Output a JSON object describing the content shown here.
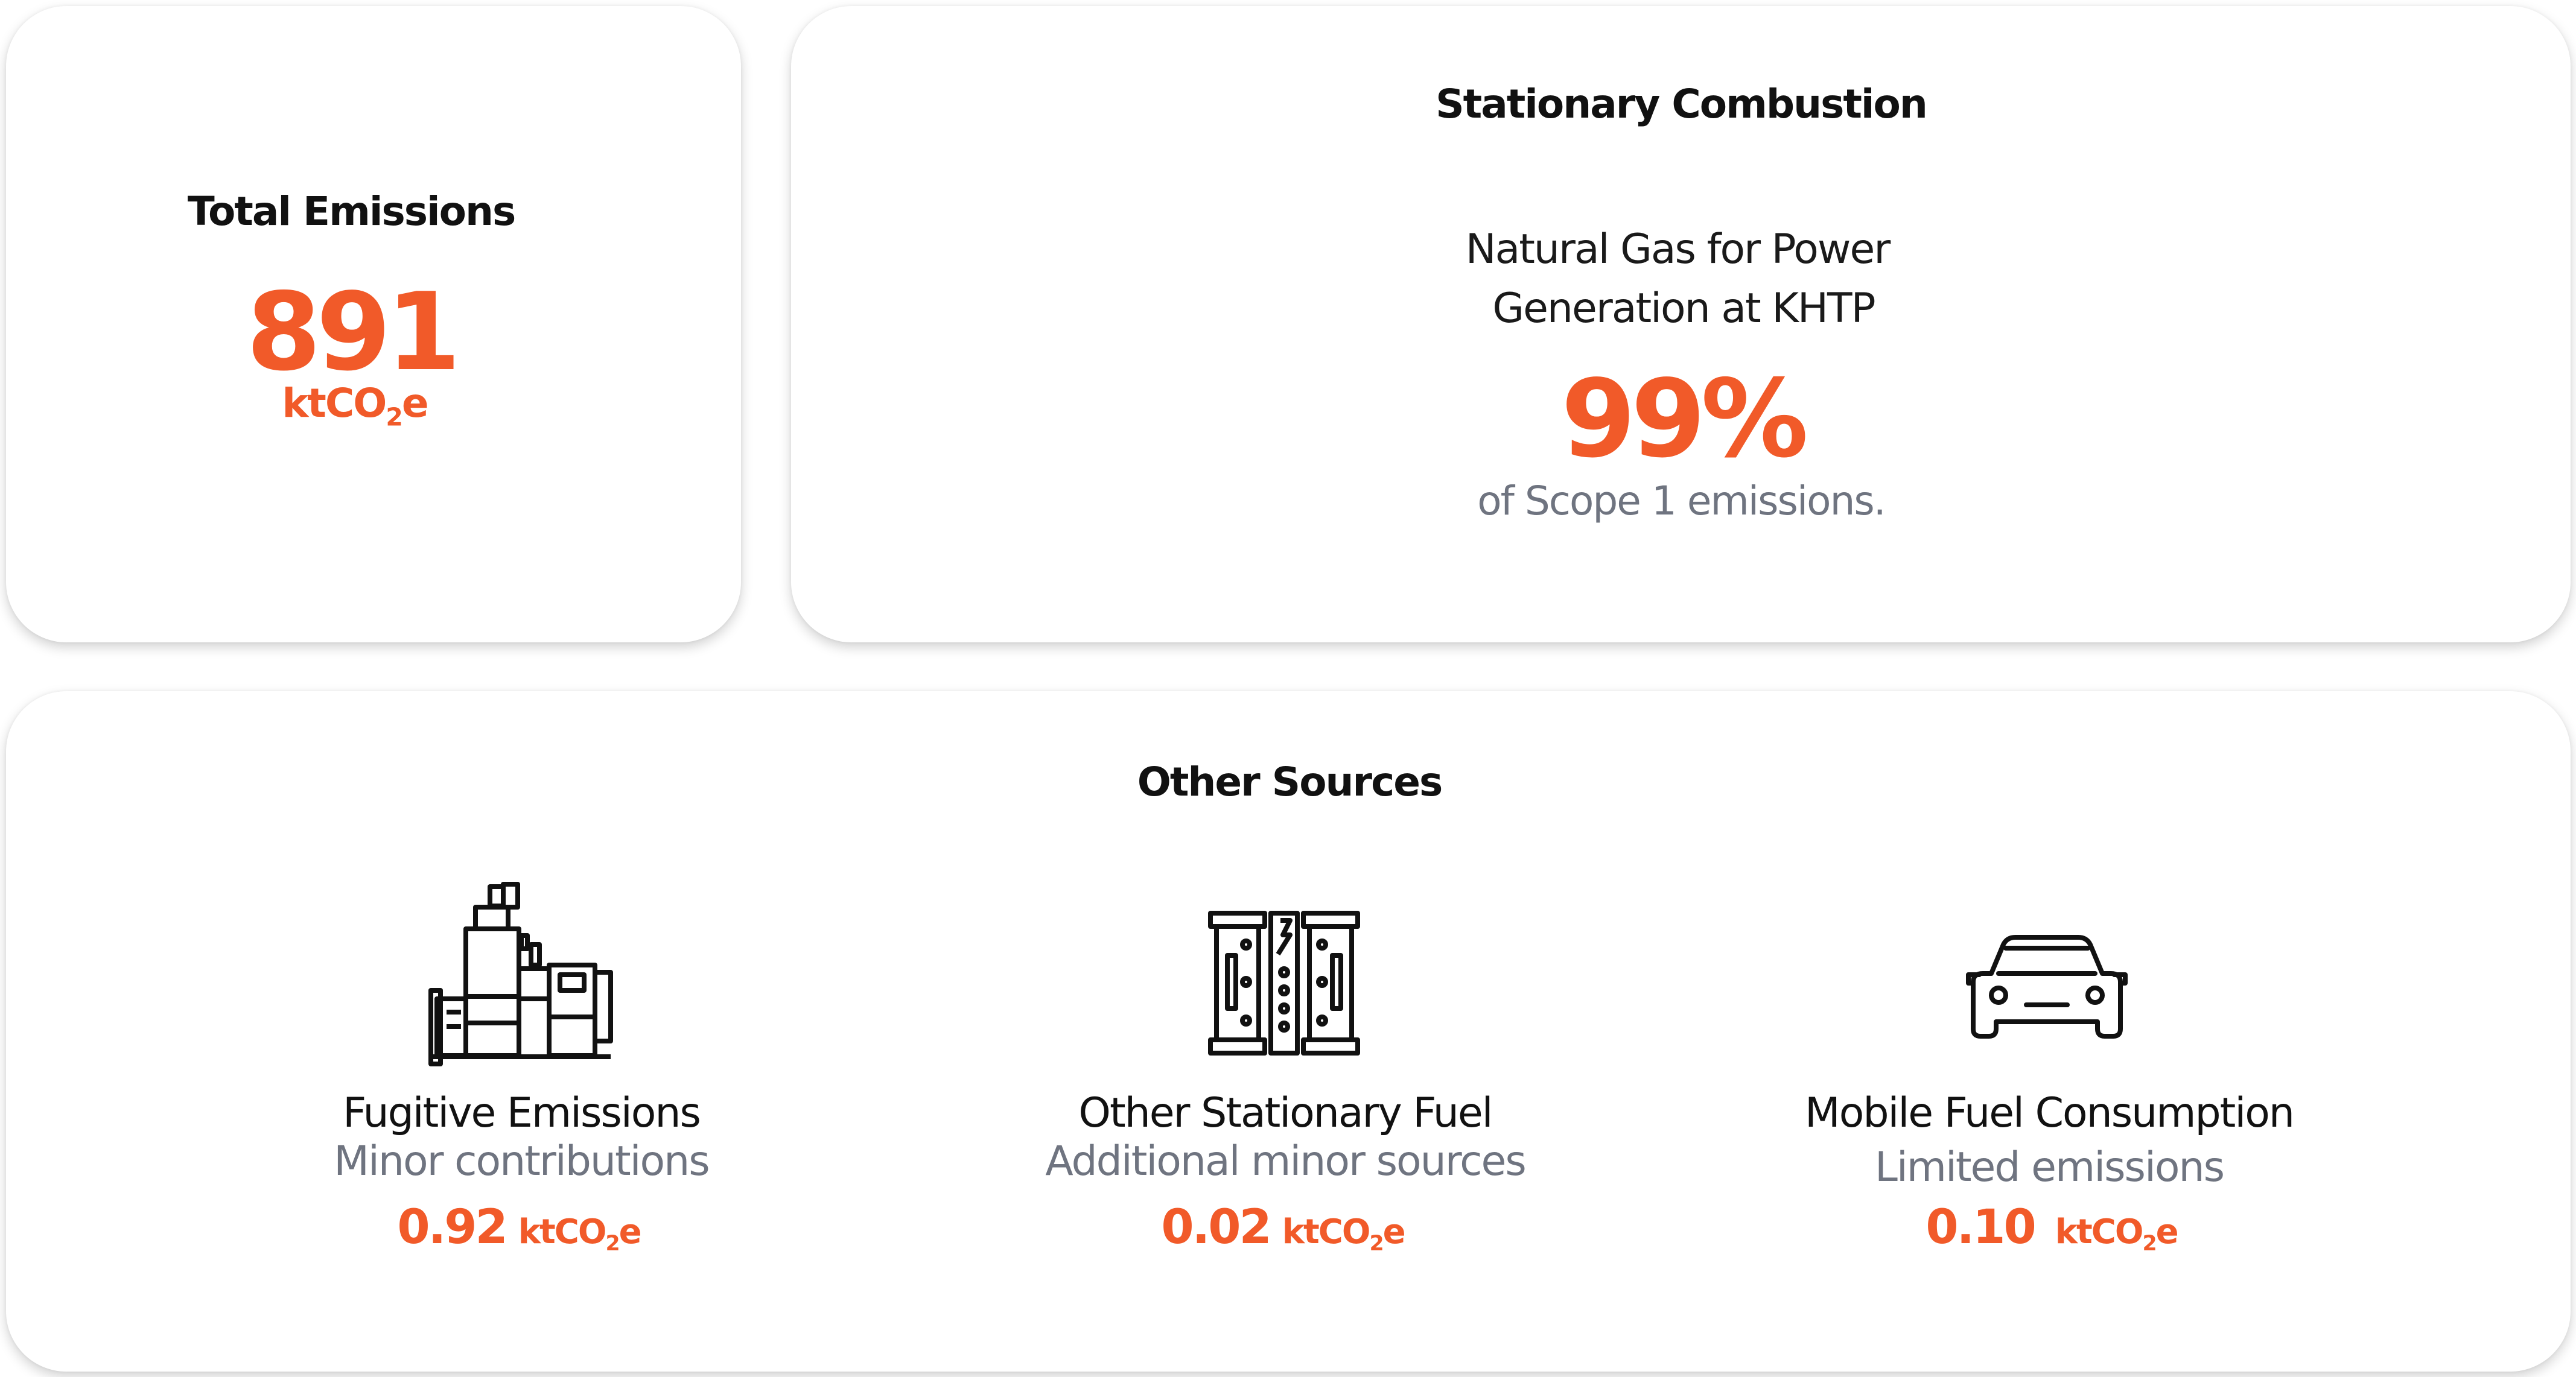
{
  "total": {
    "heading": "Total Emissions",
    "value": "891",
    "unit_prefix": "ktCO",
    "unit_sub": "2",
    "unit_suffix": "e"
  },
  "stationary": {
    "heading": "Stationary Combustion",
    "desc_line1": "Natural Gas for Power",
    "desc_line2": "Generation at KHTP",
    "percent": "99%",
    "note": "of Scope 1 emissions."
  },
  "other": {
    "heading": "Other Sources",
    "items": [
      {
        "icon": "generator-icon",
        "title": "Fugitive Emissions",
        "subtitle": "Minor contributions",
        "value": "0.92",
        "unit_prefix": "ktCO",
        "unit_sub": "2",
        "unit_suffix": "e"
      },
      {
        "icon": "fuel-cell-icon",
        "title": "Other Stationary Fuel",
        "subtitle": "Additional minor sources",
        "value": "0.02",
        "unit_prefix": "ktCO",
        "unit_sub": "2",
        "unit_suffix": "e"
      },
      {
        "icon": "car-icon",
        "title": "Mobile Fuel Consumption",
        "subtitle": "Limited emissions",
        "value": "0.10",
        "unit_prefix": "ktCO",
        "unit_sub": "2",
        "unit_suffix": "e"
      }
    ]
  },
  "colors": {
    "accent": "#f15a29",
    "muted": "#6f7480",
    "text": "#111111"
  }
}
